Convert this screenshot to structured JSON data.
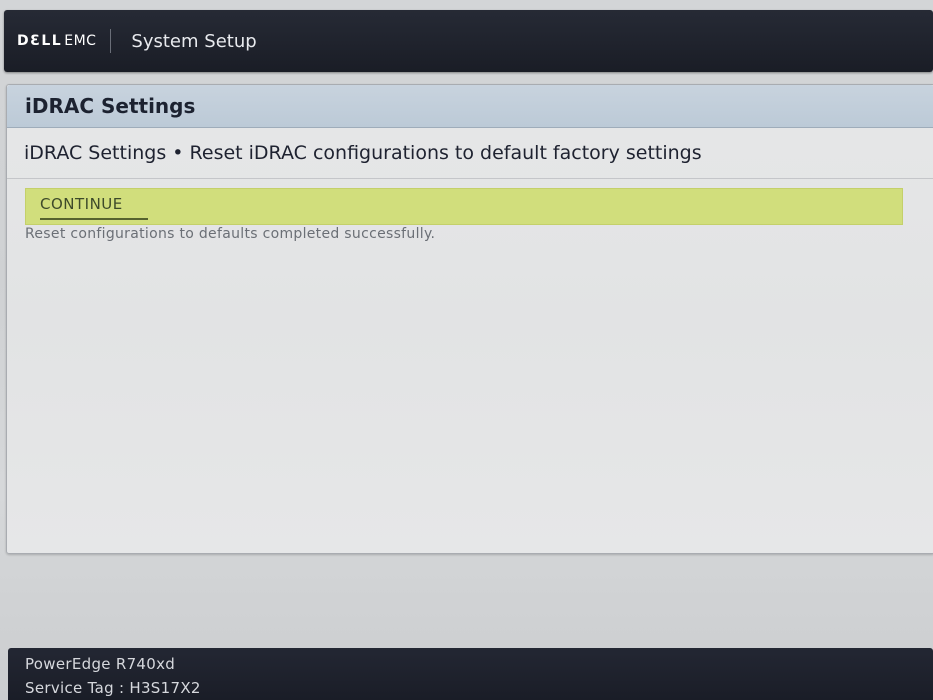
{
  "header": {
    "brand_dell": "DƐLL",
    "brand_emc": "EMC",
    "app_title": "System Setup"
  },
  "panel": {
    "title": "iDRAC Settings",
    "breadcrumb": "iDRAC Settings • Reset iDRAC configurations to default factory settings",
    "continue_label": "CONTINUE",
    "status_message": "Reset configurations to defaults completed successfully."
  },
  "footer": {
    "model": "PowerEdge R740xd",
    "service_tag": "Service Tag : H3S17X2"
  },
  "colors": {
    "header_bg": "#1f2330",
    "panel_header_bg": "#c3cfdb",
    "continue_bar_bg": "#d1de7c",
    "footer_bg": "#1f2330"
  }
}
